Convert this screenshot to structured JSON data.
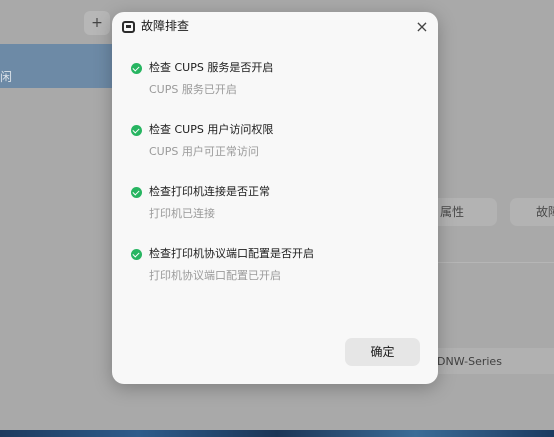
{
  "background": {
    "add_symbol": "+",
    "sidebar_selected_text": "闲",
    "attr_button": "属性",
    "fault_button": "故障",
    "printer_model": "DNW-Series"
  },
  "dialog": {
    "title": "故障排查",
    "title_icon": "printer-icon",
    "close_symbol": "×",
    "checks": [
      {
        "title": "检查 CUPS 服务是否开启",
        "status": "CUPS 服务已开启"
      },
      {
        "title": "检查 CUPS 用户访问权限",
        "status": "CUPS 用户可正常访问"
      },
      {
        "title": "检查打印机连接是否正常",
        "status": "打印机已连接"
      },
      {
        "title": "检查打印机协议端口配置是否开启",
        "status": "打印机协议端口配置已开启"
      }
    ],
    "ok_label": "确定"
  },
  "colors": {
    "success": "#27b561",
    "dialog_bg": "#f8f8f8"
  }
}
